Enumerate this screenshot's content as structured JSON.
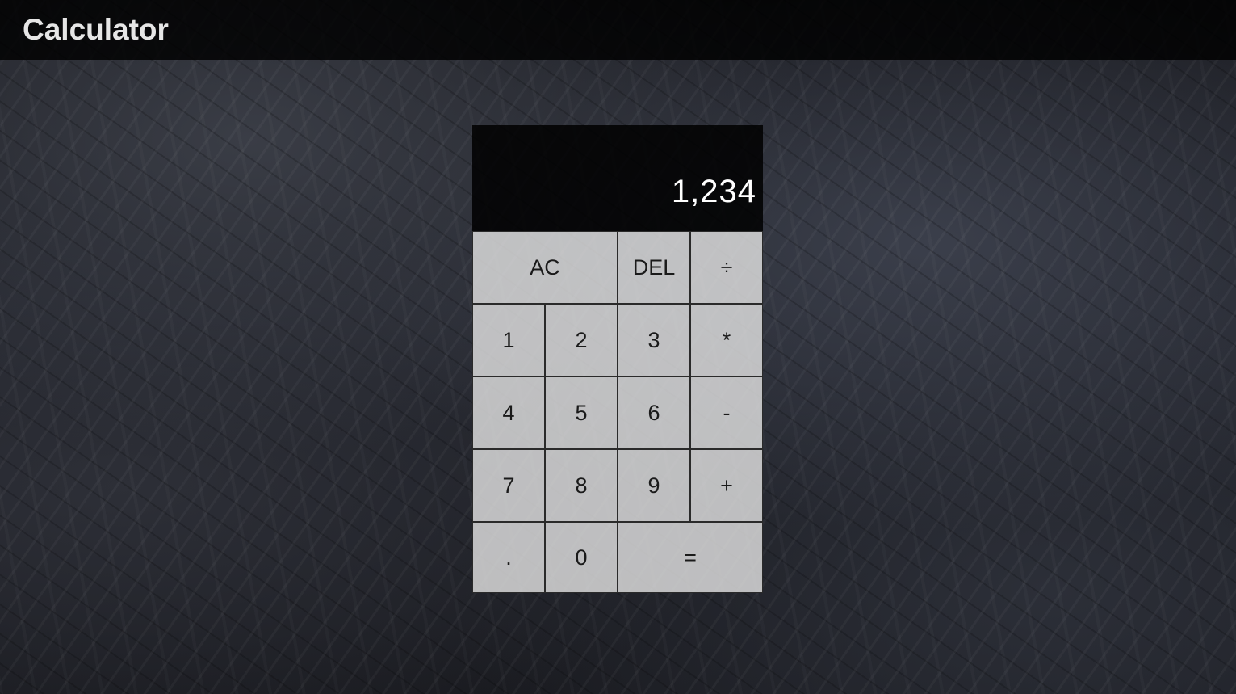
{
  "app": {
    "title": "Calculator"
  },
  "display": {
    "value": "1,234"
  },
  "keys": {
    "ac": "AC",
    "del": "DEL",
    "divide": "÷",
    "one": "1",
    "two": "2",
    "three": "3",
    "multiply": "*",
    "four": "4",
    "five": "5",
    "six": "6",
    "subtract": "-",
    "seven": "7",
    "eight": "8",
    "nine": "9",
    "add": "+",
    "decimal": ".",
    "zero": "0",
    "equals": "="
  },
  "colors": {
    "header_bg": "#000000",
    "display_bg": "#000000",
    "key_bg": "#e1e1e1",
    "key_text": "#1a1a1a",
    "display_text": "#ffffff"
  }
}
